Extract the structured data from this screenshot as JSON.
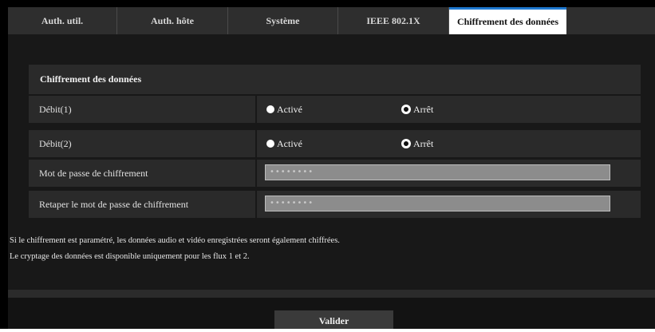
{
  "tabs": [
    {
      "label": "Auth. util.",
      "active": false
    },
    {
      "label": "Auth. hôte",
      "active": false
    },
    {
      "label": "Système",
      "active": false
    },
    {
      "label": "IEEE 802.1X",
      "active": false
    },
    {
      "label": "Chiffrement des données",
      "active": true
    }
  ],
  "section": {
    "title": "Chiffrement des données"
  },
  "rows": {
    "debit1": {
      "label": "Débit(1)",
      "option_on": "Activé",
      "option_off": "Arrêt",
      "selected": "Arrêt"
    },
    "debit2": {
      "label": "Débit(2)",
      "option_on": "Activé",
      "option_off": "Arrêt",
      "selected": "Arrêt"
    },
    "password": {
      "label": "Mot de passe de chiffrement",
      "value": "••••••••"
    },
    "password_confirm": {
      "label": "Retaper le mot de passe de chiffrement",
      "value": "••••••••"
    }
  },
  "notes": {
    "line1": "Si le chiffrement est paramétré, les données audio et vidéo enregistrées seront également chiffrées.",
    "line2": "Le cryptage des données est disponible uniquement pour les flux 1 et 2."
  },
  "submit": {
    "label": "Valider"
  },
  "colors": {
    "accent": "#1e78d0",
    "background": "#000000",
    "panel": "#181818",
    "row": "#2a2a2a"
  }
}
